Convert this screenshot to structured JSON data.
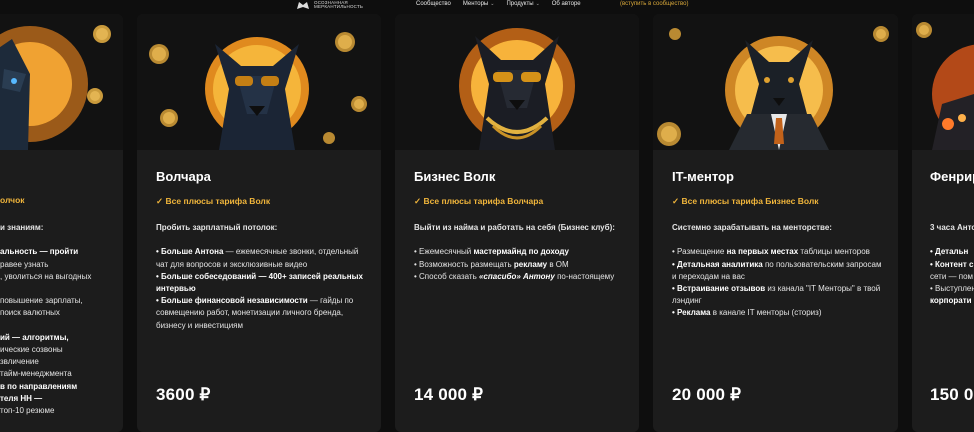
{
  "header": {
    "logo_line1": "ОСОЗНАННАЯ",
    "logo_line2": "МЕРКАНТИЛЬНОСТЬ",
    "nav": [
      "Сообщество",
      "Менторы",
      "Продукты",
      "Об авторе"
    ],
    "join_link": "(вступить в сообщество)"
  },
  "cards": [
    {
      "title": "",
      "perk": "олчок",
      "intro": "и знаниям:",
      "lines": [
        "альность — пройти",
        "равее узнать",
        ", уволиться на выгодных",
        "",
        "повышение зарплаты,",
        "поиск валютных",
        "",
        "ий — алгоритмы,",
        "ические созвоны",
        "звличение",
        "тайм-менеджмента",
        "в по направлениям",
        "теля НН —",
        "топ-10 резюме"
      ]
    },
    {
      "title": "Волчара",
      "perk": "✓ Все плюсы тарифа Волк",
      "intro": "Пробить зарплатный потолок:",
      "items": [
        {
          "bold": "• Больше Антона",
          "text": " — ежемесячные звонки, отдельный чат для вопросов и эксклюзивные видео"
        },
        {
          "bold": "• Больше собеседований — 400+ записей реальных интервью",
          "text": ""
        },
        {
          "bold": "• Больше финансовой независимости",
          "text": " — гайды по совмещению работ, монетизации личного бренда, бизнесу и инвестициям"
        }
      ],
      "price": "3600 ₽"
    },
    {
      "title": "Бизнес Волк",
      "perk": "✓ Все плюсы тарифа Волчара",
      "intro": "Выйти из найма и работать на себя (Бизнес клуб):",
      "items": [
        {
          "pre": "• Ежемесячный ",
          "bold": "мастермайнд по доходу",
          "post": ""
        },
        {
          "pre": "• Возможность размещать ",
          "bold": "рекламу",
          "post": " в ОМ"
        },
        {
          "pre": "• Способ сказать ",
          "bold": "«спасибо» Антону",
          "post": " по-настоящему"
        }
      ],
      "price": "14 000 ₽"
    },
    {
      "title": "IT-ментор",
      "perk": "✓ Все плюсы тарифа Бизнес Волк",
      "intro": "Системно зарабатывать на менторстве:",
      "items": [
        {
          "pre": "• Размещение ",
          "bold": "на первых местах",
          "post": " таблицы менторов"
        },
        {
          "pre": "",
          "bold": "• Детальная аналитика",
          "post": " по пользовательским запросам и переходам на вас"
        },
        {
          "pre": "",
          "bold": "• Встраивание отзывов",
          "post": " из канала \"IT Менторы\" в твой лэндинг"
        },
        {
          "pre": "",
          "bold": "• Реклама",
          "post": " в канале IT менторы (сториз)"
        }
      ],
      "price": "20 000 ₽"
    },
    {
      "title": "Фенрир",
      "perk": "",
      "intro": "3 часа Анто",
      "lines": [
        "• Детальн",
        "• Контент с",
        "сети — пом",
        "• Выступлен",
        "корпорати"
      ],
      "price": "150 0"
    }
  ]
}
